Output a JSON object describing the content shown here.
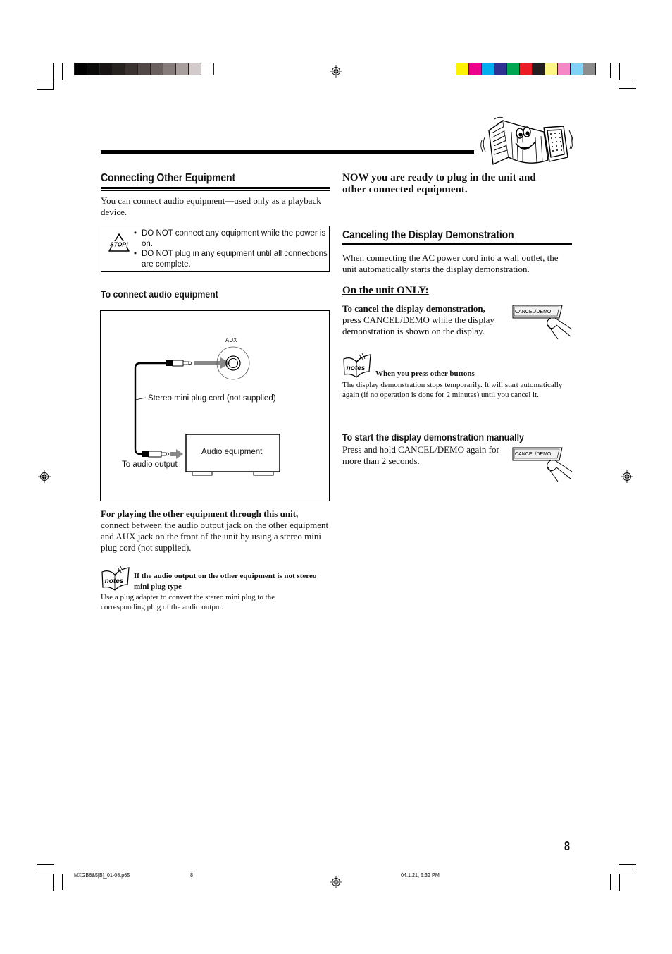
{
  "colorbars": {
    "left": [
      "#000000",
      "#0b0a09",
      "#161312",
      "#252220",
      "#3a3231",
      "#504746",
      "#6a605e",
      "#857c7b",
      "#a89f9e",
      "#d3cbcb",
      "#ffffff"
    ],
    "right": [
      "#fff200",
      "#ec008c",
      "#00aeef",
      "#2e3192",
      "#00a651",
      "#ed1c24",
      "#231f20",
      "#fff685",
      "#f687c6",
      "#7fd3f7",
      "#8c8c8c"
    ]
  },
  "left_column": {
    "heading": "Connecting Other Equipment",
    "intro": "You can connect audio equipment—used only as a playback device.",
    "caution": {
      "icon_label": "STOP!",
      "items": [
        "DO NOT connect any equipment while the power is on.",
        "DO NOT plug in any equipment until all connections are complete."
      ]
    },
    "subheading": "To connect audio equipment",
    "diagram": {
      "jack_label": "AUX",
      "cord_label": "Stereo mini plug cord (not supplied)",
      "device_label": "Audio equipment",
      "output_label": "To audio output"
    },
    "instruction_bold": "For playing the other equipment through this unit,",
    "instruction_text": "connect between the audio output jack on the other equipment and AUX jack on the front of the unit by using a stereo mini plug cord (not supplied).",
    "note": {
      "icon_label": "notes",
      "title": "If the audio output on the other equipment is not stereo mini plug type",
      "text": "Use a plug adapter to convert the stereo mini plug to the corresponding plug of the audio output."
    }
  },
  "right_column": {
    "ready_text": "NOW you are ready to plug in the unit and other connected equipment.",
    "heading": "Canceling the Display Demonstration",
    "intro": "When connecting the AC power cord into a wall outlet, the unit automatically starts the display demonstration.",
    "unit_only": "On the unit ONLY:",
    "cancel_bold": "To cancel the display demonstration,",
    "cancel_text": "press CANCEL/DEMO while the display demonstration is shown on the display.",
    "button_label": "CANCEL/DEMO",
    "note": {
      "icon_label": "notes",
      "title": "When you press other buttons",
      "text": "The display demonstration stops temporarily. It will start automatically again (if no operation is done for 2 minutes) until you cancel it."
    },
    "manual_heading": "To start the display demonstration manually",
    "manual_text": "Press and hold CANCEL/DEMO again for more than 2 seconds."
  },
  "page_number": "8",
  "footer": {
    "file": "MXGB6&5[B]_01-08.p65",
    "page": "8",
    "timestamp": "04.1.21, 5:32 PM"
  }
}
